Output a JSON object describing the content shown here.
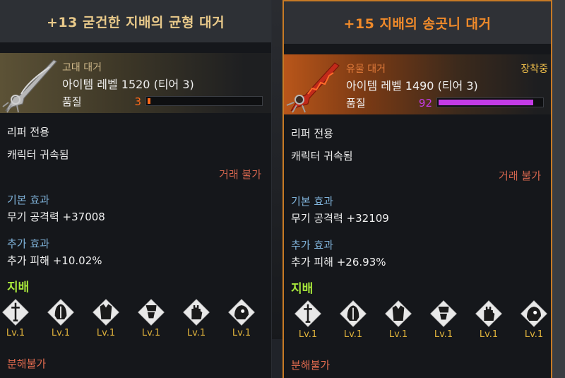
{
  "left": {
    "title": "+13 굳건한 지배의 균형 대거",
    "title_color": "#e8c98a",
    "grade": "고대 대거",
    "grade_color": "#cfb88a",
    "item_level": "아이템 레벨 1520 (티어 3)",
    "quality_label": "품질",
    "quality_value": "3",
    "quality_percent": 3,
    "quality_color": "#ff6a1a",
    "class_restrict": "리퍼 전용",
    "bound": "캐릭터 귀속됨",
    "trade": "거래 불가",
    "base_effect_title": "기본 효과",
    "base_effect": "무기 공격력 +37008",
    "extra_effect_title": "추가 효과",
    "extra_effect": "추가 피해 +10.02%",
    "dominion_title": "지배",
    "set_icons": [
      {
        "icon": "sword-emblem-icon",
        "level": "Lv.1"
      },
      {
        "icon": "helmet-icon",
        "level": "Lv.1"
      },
      {
        "icon": "chest-armor-icon",
        "level": "Lv.1"
      },
      {
        "icon": "pants-icon",
        "level": "Lv.1"
      },
      {
        "icon": "glove-icon",
        "level": "Lv.1"
      },
      {
        "icon": "shoulder-icon",
        "level": "Lv.1"
      }
    ],
    "disassemble": "분해불가"
  },
  "right": {
    "title": "+15 지배의 송곳니 대거",
    "title_color": "#f08a2a",
    "grade": "유물 대거",
    "grade_color": "#e07a3a",
    "item_level": "아이템 레벨 1490 (티어 3)",
    "quality_label": "품질",
    "quality_value": "92",
    "quality_percent": 92,
    "quality_color": "#c43be6",
    "equipped": "장착중",
    "class_restrict": "리퍼 전용",
    "bound": "캐릭터 귀속됨",
    "trade": "거래 불가",
    "base_effect_title": "기본 효과",
    "base_effect": "무기 공격력 +32109",
    "extra_effect_title": "추가 효과",
    "extra_effect": "추가 피해 +26.93%",
    "dominion_title": "지배",
    "set_icons": [
      {
        "icon": "sword-emblem-icon",
        "level": "Lv.1"
      },
      {
        "icon": "helmet-icon",
        "level": "Lv.1"
      },
      {
        "icon": "chest-armor-icon",
        "level": "Lv.1"
      },
      {
        "icon": "pants-icon",
        "level": "Lv.1"
      },
      {
        "icon": "glove-icon",
        "level": "Lv.1"
      },
      {
        "icon": "shoulder-icon",
        "level": "Lv.1"
      }
    ],
    "disassemble": "분해불가"
  }
}
